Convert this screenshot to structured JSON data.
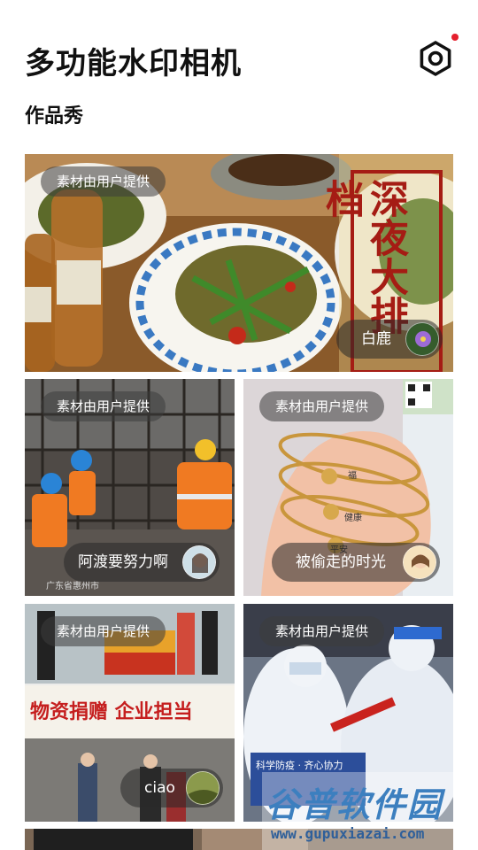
{
  "header": {
    "title": "多功能水印相机"
  },
  "section": {
    "title": "作品秀"
  },
  "cards": [
    {
      "tag": "素材由用户提供",
      "user": "白鹿",
      "overlay_text": "深夜大排档"
    },
    {
      "tag": "素材由用户提供",
      "user": "阿渡要努力啊",
      "overlay_text": "广东省惠州市"
    },
    {
      "tag": "素材由用户提供",
      "user": "被偷走的时光",
      "labels": [
        "福",
        "健康",
        "平安"
      ]
    },
    {
      "tag": "素材由用户提供",
      "user": "ciao",
      "overlay_text": "物资捐赠 企业担当"
    },
    {
      "tag": "素材由用户提供",
      "user": "",
      "overlay_text": "科学防疫 · 齐心协力"
    }
  ],
  "watermark": {
    "main": "谷普软件园",
    "sub": "www.gupuxiazai.com"
  },
  "colors": {
    "accent_dot": "#e5202d",
    "pill_bg": "rgba(40,40,40,0.55)"
  },
  "icons": {
    "settings": "hexagon-gear-icon"
  }
}
